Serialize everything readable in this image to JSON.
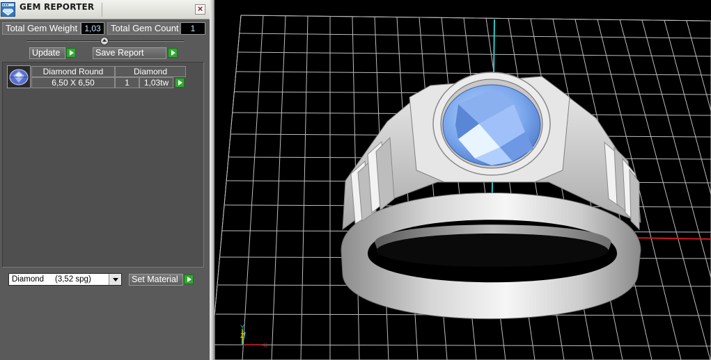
{
  "window": {
    "title": "GEM REPORTER",
    "close_label": "×"
  },
  "totals": {
    "weight_label": "Total Gem Weight",
    "weight_value": "1,03",
    "count_label": "Total Gem Count",
    "count_value": "1"
  },
  "actions": {
    "update_label": "Update",
    "save_label": "Save Report"
  },
  "gem_list": {
    "items": [
      {
        "name": "Diamond Round",
        "size": "6,50 X 6,50",
        "material": "Diamond",
        "count": "1",
        "weight": "1,03tw"
      }
    ]
  },
  "material": {
    "selected": "Diamond     (3,52 spg)",
    "set_label": "Set Material"
  },
  "viewport": {
    "axis_labels": {
      "x": "X",
      "y": "Y",
      "z": "Z"
    },
    "colors": {
      "x_axis": "#d01c1c",
      "y_axis": "#2ec8cc",
      "z_axis": "#e0d020",
      "gem": "#7aa6ec",
      "metal": "#d8d8d8"
    }
  }
}
